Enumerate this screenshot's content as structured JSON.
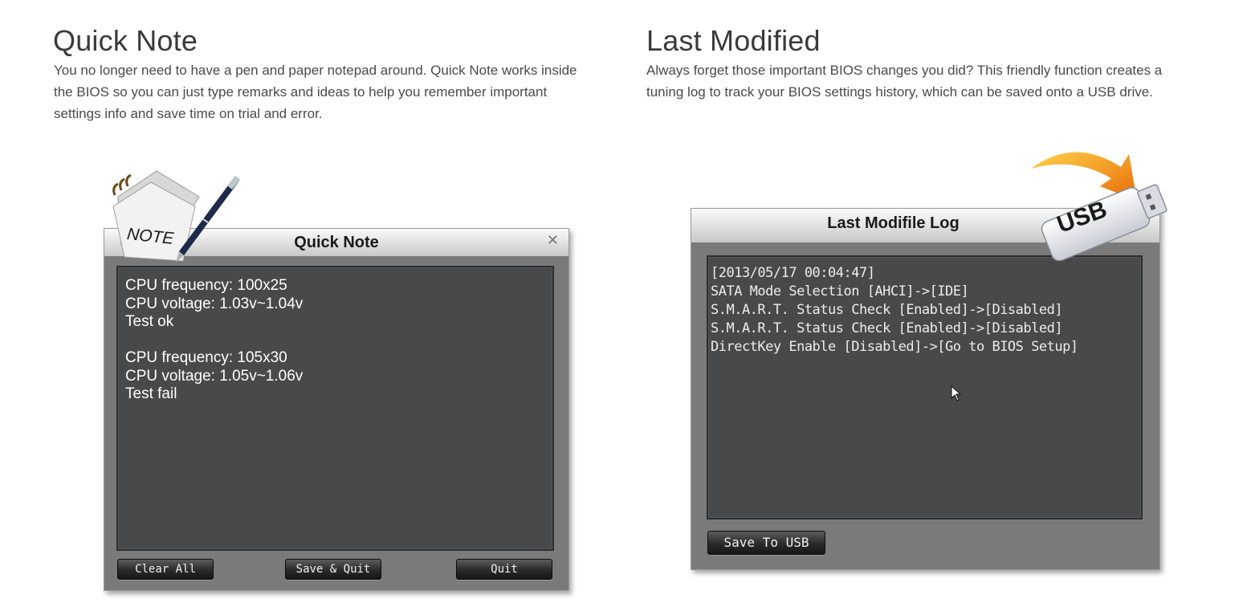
{
  "quick_note_section": {
    "title": "Quick Note",
    "description_lines": [
      "You no longer need to have a pen and paper notepad around. Quick Note works inside",
      "the BIOS so you can just type remarks and ideas to help you remember important",
      "settings info and save time on trial and error."
    ]
  },
  "last_modified_section": {
    "title": "Last Modified",
    "description_lines": [
      "Always forget those important BIOS changes you did? This friendly function creates a",
      "tuning log to track your BIOS settings history, which can be saved onto a USB drive."
    ]
  },
  "quick_note_window": {
    "title": "Quick Note",
    "close_icon": "close-icon",
    "note_badge": "NOTE",
    "note_lines": [
      "CPU frequency: 100x25",
      "CPU voltage: 1.03v~1.04v",
      "Test ok",
      "",
      "CPU frequency: 105x30",
      "CPU voltage: 1.05v~1.06v",
      "Test fail"
    ],
    "buttons": {
      "clear_all": "Clear All",
      "save_quit": "Save & Quit",
      "quit": "Quit"
    }
  },
  "last_modified_window": {
    "title": "Last Modifile Log",
    "usb_badge": "USB",
    "log_lines": [
      "[2013/05/17 00:04:47]",
      "SATA Mode Selection [AHCI]->[IDE]",
      "S.M.A.R.T. Status Check [Enabled]->[Disabled]",
      "S.M.A.R.T. Status Check [Enabled]->[Disabled]",
      "DirectKey Enable [Disabled]->[Go to BIOS Setup]"
    ],
    "buttons": {
      "save_to_usb": "Save To USB"
    }
  },
  "colors": {
    "window_frame": "#7a7a7a",
    "screen_bg": "#48494b",
    "accent_orange": "#f08a12"
  }
}
